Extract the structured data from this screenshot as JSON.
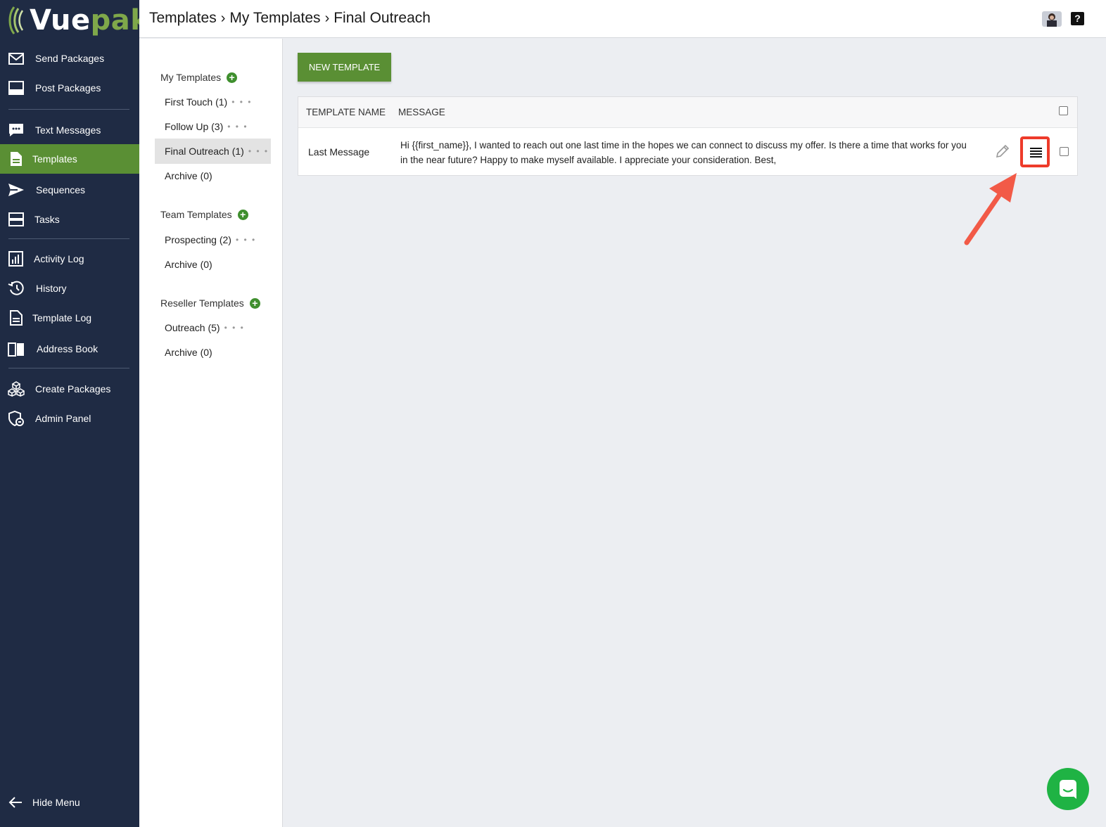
{
  "app": {
    "logo_a": "Vue",
    "logo_b": "pak"
  },
  "sidebar": {
    "items": [
      {
        "label": "Send Packages",
        "icon": "mail-icon"
      },
      {
        "label": "Post Packages",
        "icon": "inbox-icon"
      },
      {
        "label": "Text Messages",
        "icon": "chat-icon"
      },
      {
        "label": "Templates",
        "icon": "document-icon",
        "active": true
      },
      {
        "label": "Sequences",
        "icon": "send-icon"
      },
      {
        "label": "Tasks",
        "icon": "tasks-icon"
      },
      {
        "label": "Activity Log",
        "icon": "chart-icon"
      },
      {
        "label": "History",
        "icon": "history-icon"
      },
      {
        "label": "Template Log",
        "icon": "document-icon"
      },
      {
        "label": "Address Book",
        "icon": "book-icon"
      },
      {
        "label": "Create Packages",
        "icon": "cubes-icon"
      },
      {
        "label": "Admin Panel",
        "icon": "admin-icon"
      }
    ],
    "hide_menu": "Hide Menu"
  },
  "header": {
    "crumbs": [
      "Templates",
      "My Templates",
      "Final Outreach"
    ],
    "help": "?"
  },
  "folders": {
    "my": {
      "title": "My Templates",
      "items": [
        "First Touch (1)",
        "Follow Up (3)",
        "Final Outreach (1)",
        "Archive (0)"
      ]
    },
    "team": {
      "title": "Team Templates",
      "items": [
        "Prospecting (2)",
        "Archive (0)"
      ]
    },
    "reseller": {
      "title": "Reseller Templates",
      "items": [
        "Outreach (5)",
        "Archive (0)"
      ]
    },
    "dots": "• • •"
  },
  "main": {
    "new_button": "NEW TEMPLATE",
    "columns": {
      "name": "TEMPLATE NAME",
      "message": "MESSAGE"
    },
    "rows": [
      {
        "name": "Last Message",
        "message": "Hi {{first_name}}, I wanted to reach out one last time in the hopes we can connect to discuss my offer. Is there a time that works for you in the near future? Happy to make myself available. I appreciate your consideration. Best,"
      }
    ]
  },
  "colors": {
    "sidebar": "#1f2b44",
    "accent": "#5a8f34",
    "highlight": "#ee3b2a",
    "chat": "#1fb344"
  }
}
